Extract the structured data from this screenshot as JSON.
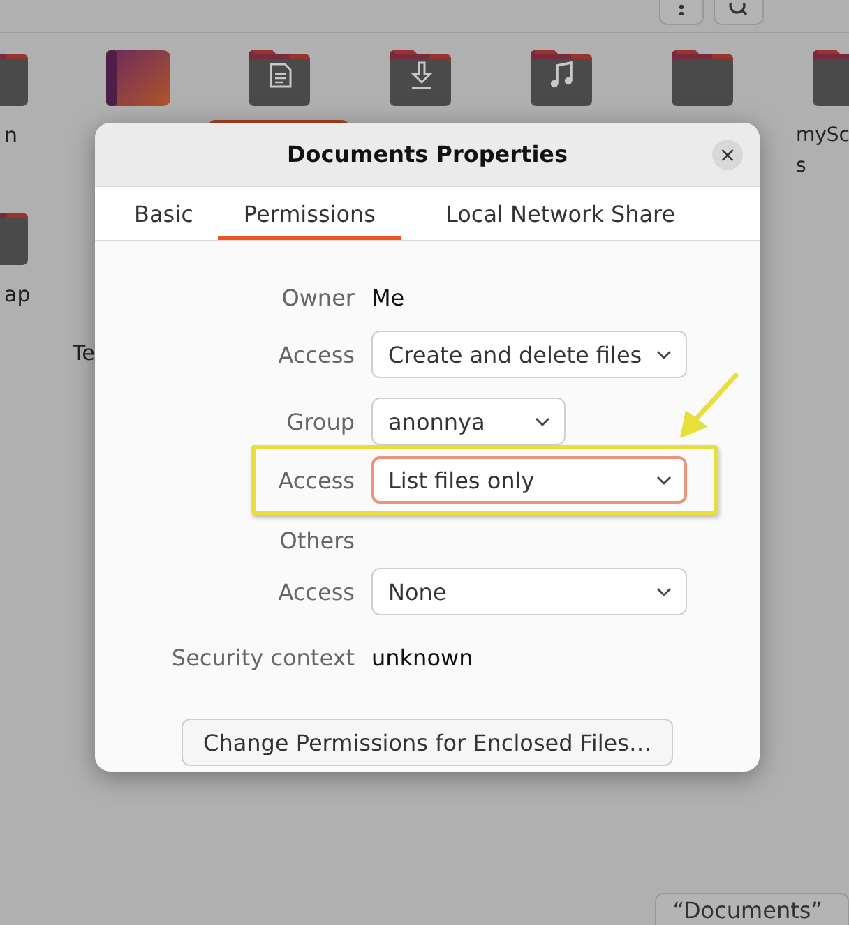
{
  "file_manager": {
    "toolbar_buttons": [
      {
        "kind": "menu"
      },
      {
        "kind": "search"
      }
    ],
    "icon_rows": [
      [
        {
          "kind": "folder",
          "label": [
            "n"
          ],
          "selected": false
        },
        {
          "kind": "desktop",
          "selected": false
        },
        {
          "kind": "documents",
          "selected": true
        },
        {
          "kind": "downloads",
          "selected": false
        },
        {
          "kind": "music",
          "selected": false
        },
        {
          "kind": "folder",
          "selected": false
        },
        {
          "kind": "folder",
          "label": [
            "mySc",
            "s"
          ],
          "selected": false
        }
      ],
      [
        {
          "kind": "folder",
          "label": [
            "ap"
          ],
          "selected": false
        },
        {
          "kind": "none",
          "label": [
            "Te"
          ],
          "selected": false
        }
      ]
    ],
    "status": "“Documents”"
  },
  "dialog": {
    "title": "Documents Properties",
    "close": "×",
    "tabs": [
      {
        "label": "Basic",
        "selected": false
      },
      {
        "label": "Permissions",
        "selected": true
      },
      {
        "label": "Local Network Share",
        "selected": false
      }
    ],
    "sections": [
      [
        {
          "kind": "text",
          "label": "Owner",
          "value": "Me"
        },
        {
          "kind": "dropdown",
          "label": "Access",
          "value": "Create and delete files",
          "focused": false,
          "annotated": false
        }
      ],
      [
        {
          "kind": "dropdown",
          "label": "Group",
          "value": "anonnya",
          "focused": false,
          "annotated": false
        },
        {
          "kind": "dropdown",
          "label": "Access",
          "value": "List files only",
          "focused": true,
          "annotated": true
        }
      ],
      [
        {
          "kind": "heading",
          "label": "Others"
        },
        {
          "kind": "dropdown",
          "label": "Access",
          "value": "None",
          "focused": false,
          "annotated": false
        }
      ],
      [
        {
          "kind": "text",
          "label": "Security context",
          "value": "unknown"
        }
      ]
    ],
    "button": "Change Permissions for Enclosed Files…"
  }
}
